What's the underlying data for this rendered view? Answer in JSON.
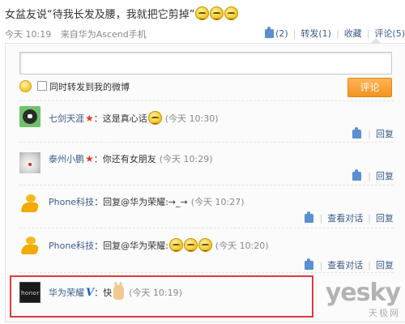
{
  "post": {
    "text": "女盆友说“待我长发及腰，我就把它剪掉”",
    "time": "今天 10:19",
    "source": "来自华为Ascend手机"
  },
  "actions": {
    "like_count": "(2)",
    "repost": "转发(1)",
    "favorite": "收藏",
    "comment": "评论(5)"
  },
  "composer": {
    "input_value": "",
    "also_repost_label": "同时转发到我的微博",
    "submit_label": "评论"
  },
  "comments": [
    {
      "name": "七剑天涯",
      "badge": "star",
      "text": "：这是真心话",
      "time": "(今天 10:30)",
      "actions": [
        "回复"
      ]
    },
    {
      "name": "泰州小鹏",
      "badge": "star",
      "text": "：你还有女朋友",
      "time": "(今天 10:29)",
      "actions": [
        "回复"
      ]
    },
    {
      "name": "Phone科技",
      "badge": "",
      "text": "：回复@华为荣耀:→_→",
      "time": "(今天 10:27)",
      "actions": [
        "查看对话",
        "回复"
      ]
    },
    {
      "name": "Phone科技",
      "badge": "",
      "text": "：回复@华为荣耀:",
      "time": "(今天 10:20)",
      "actions": [
        "查看对话",
        "回复"
      ]
    },
    {
      "name": "华为荣耀",
      "badge": "V",
      "text": "：快",
      "time": "(今天 10:19)",
      "actions": []
    }
  ],
  "watermark": {
    "main": "yesky",
    "sub": "天极网"
  },
  "colors": {
    "link": "#3a5c8a",
    "submit": "#f39420",
    "highlight": "#e13a3a",
    "star": "#e8372b",
    "verified": "#1b5fd0"
  }
}
